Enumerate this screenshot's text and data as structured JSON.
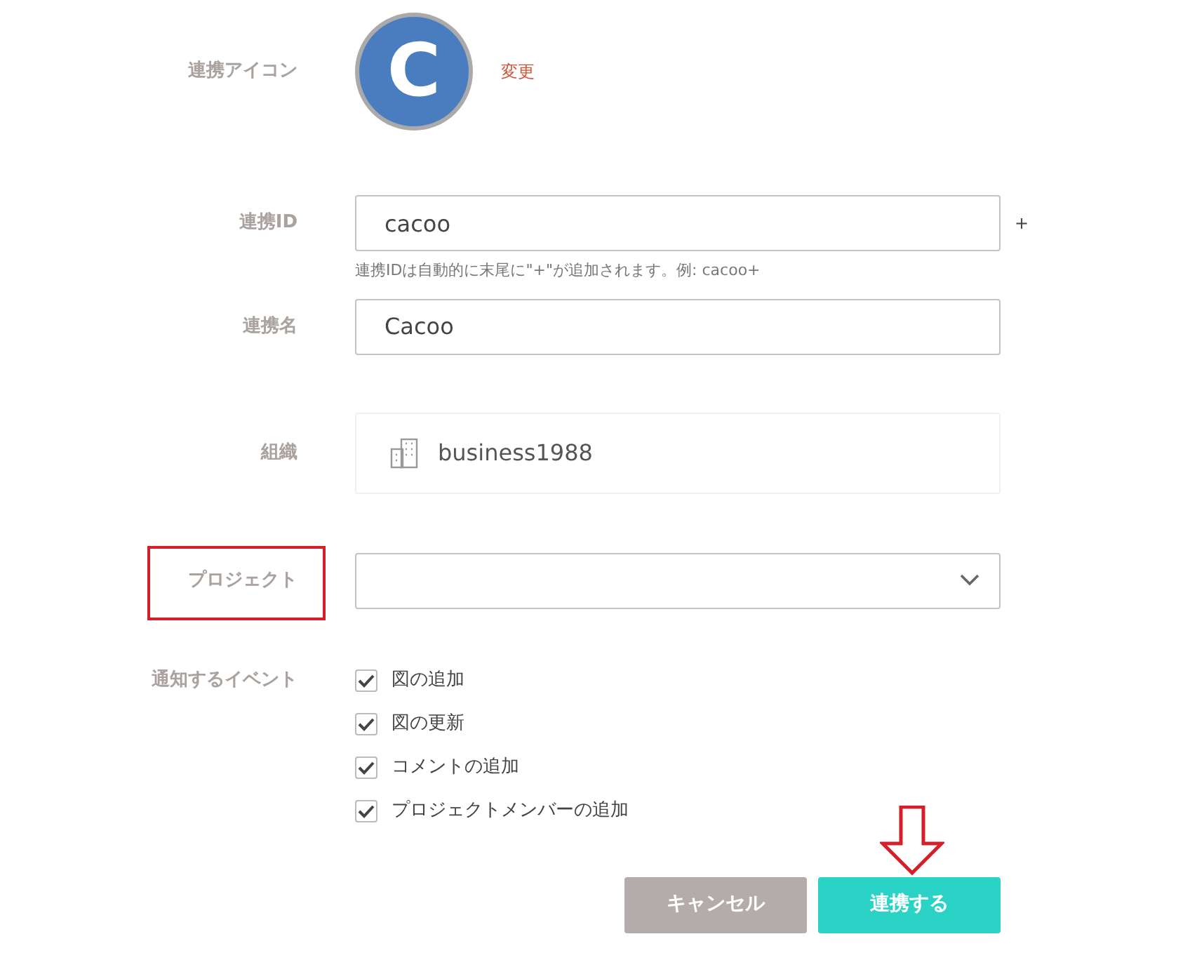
{
  "icon_row": {
    "label": "連携アイコン",
    "icon_letter": "C",
    "change_link": "変更"
  },
  "id_row": {
    "label": "連携ID",
    "value": "cacoo",
    "suffix": "+",
    "hint": "連携IDは自動的に末尾に\"+\"が追加されます。例: cacoo+"
  },
  "name_row": {
    "label": "連携名",
    "value": "Cacoo"
  },
  "org_row": {
    "label": "組織",
    "value": "business1988"
  },
  "project_row": {
    "label": "プロジェクト",
    "highlighted": true
  },
  "events": {
    "label": "通知するイベント",
    "items": [
      {
        "label": "図の追加",
        "checked": true
      },
      {
        "label": "図の更新",
        "checked": true
      },
      {
        "label": "コメントの追加",
        "checked": true
      },
      {
        "label": "プロジェクトメンバーの追加",
        "checked": true
      }
    ]
  },
  "buttons": {
    "cancel": "キャンセル",
    "submit": "連携する",
    "submit_arrow": true
  }
}
